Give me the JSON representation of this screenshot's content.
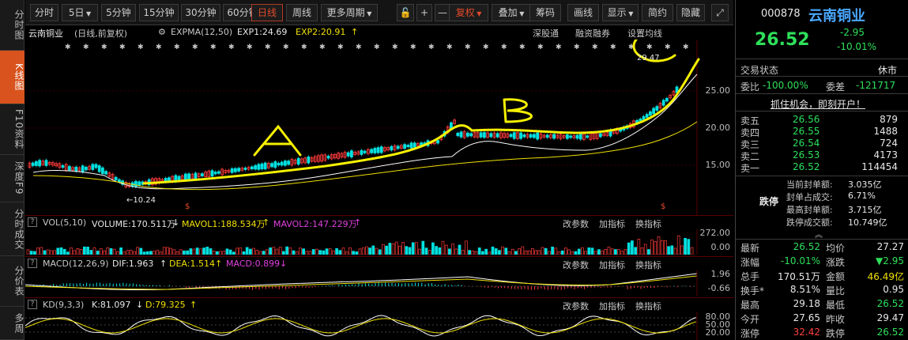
{
  "left_tabs": [
    "分时图",
    "K线图",
    "F10资料",
    "深度F9",
    "分时成交",
    "分价表",
    "多周"
  ],
  "toolbar": {
    "buttons": [
      "分时",
      "5日",
      "5分钟",
      "15分钟",
      "30分钟",
      "60分钟",
      "日线",
      "周线",
      "更多周期",
      "复权",
      "叠加",
      "筹码",
      "画线",
      "显示",
      "简约",
      "隐藏"
    ],
    "active": "日线"
  },
  "kheader": {
    "stock": "云南铜业",
    "mode": "(日线,前复权)",
    "expma": "EXPMA(12,50)",
    "exp1": "EXP1:24.69",
    "exp2": "EXP2:20.91",
    "links": [
      "深股通",
      "融资融券",
      "设置均线"
    ]
  },
  "main_axis": [
    "25.00",
    "20.00",
    "15.00"
  ],
  "main_annotations": {
    "high": "29.47",
    "low": "10.24"
  },
  "overlay_letters": [
    "A",
    "B"
  ],
  "vol_panel": {
    "title": "VOL(5,10)",
    "volume": "VOLUME:170.511万",
    "mavol1": "MAVOL1:188.534万",
    "mavol2": "MAVOL2:147.229万",
    "links": [
      "改参数",
      "加指标",
      "换指标"
    ],
    "axis": [
      "272.00",
      "0.00"
    ]
  },
  "macd_panel": {
    "title": "MACD(12,26,9)",
    "dif": "DIF:1.963",
    "dea": "DEA:1.514",
    "macd": "MACD:0.899",
    "links": [
      "改参数",
      "加指标",
      "换指标"
    ],
    "axis": [
      "1.96",
      "-0.66"
    ]
  },
  "kd_panel": {
    "title": "KD(9,3,3)",
    "k": "K:81.097",
    "d": "D:79.325",
    "links": [
      "改参数",
      "加指标",
      "换指标"
    ],
    "axis": [
      "80.00",
      "50.00",
      "20.00"
    ]
  },
  "quote": {
    "code": "000878",
    "name": "云南铜业",
    "price": "26.52",
    "change": "-2.95",
    "pct": "-10.01%",
    "status_label": "交易状态",
    "status_value": "休市",
    "weibi_label": "委比",
    "weibi_value": "-100.00%",
    "weicha_label": "委差",
    "weicha_value": "-121717",
    "promo": "抓住机会，即刻开户！",
    "asks": [
      {
        "label": "卖五",
        "price": "26.56",
        "vol": "879"
      },
      {
        "label": "卖四",
        "price": "26.55",
        "vol": "1488"
      },
      {
        "label": "卖三",
        "price": "26.54",
        "vol": "724"
      },
      {
        "label": "卖二",
        "price": "26.53",
        "vol": "4173"
      },
      {
        "label": "卖一",
        "price": "26.52",
        "vol": "114454"
      }
    ],
    "limit_label": "跌停",
    "limit_info": [
      {
        "k": "当前封单额:",
        "v": "3.035亿"
      },
      {
        "k": "封单占成交:",
        "v": "6.71%"
      },
      {
        "k": "最高封单额:",
        "v": "3.715亿"
      },
      {
        "k": "跌停成交额:",
        "v": "10.749亿"
      }
    ],
    "stats": [
      {
        "k1": "最新",
        "v1": "26.52",
        "k2": "均价",
        "v2": "27.27"
      },
      {
        "k1": "涨幅",
        "v1": "-10.01%",
        "k2": "涨跌",
        "v2": "▼2.95"
      },
      {
        "k1": "总手",
        "v1": "170.51万",
        "k2": "金额",
        "v2": "46.49亿"
      },
      {
        "k1": "换手*",
        "v1": "8.51%",
        "k2": "量比",
        "v2": "0.95"
      },
      {
        "k1": "最高",
        "v1": "29.18",
        "k2": "最低",
        "v2": "26.52"
      },
      {
        "k1": "今开",
        "v1": "27.65",
        "k2": "昨收",
        "v2": "29.47"
      },
      {
        "k1": "涨停",
        "v1": "32.42",
        "k2": "跌停",
        "v2": "26.52"
      }
    ]
  },
  "colors": {
    "up": "#ff3b3b",
    "down": "#00e0e0",
    "exp1": "#ffffff",
    "exp2": "#f0e000",
    "annot": "#f5f000"
  }
}
